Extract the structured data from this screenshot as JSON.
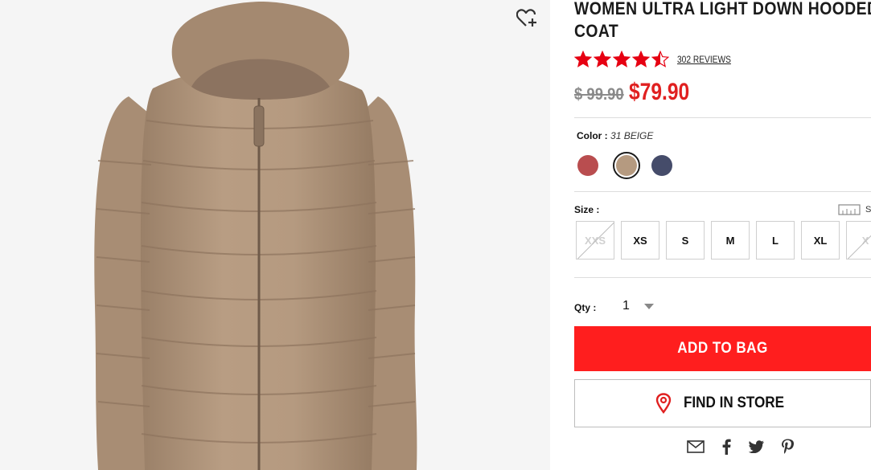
{
  "product": {
    "title_line1": "WOMEN ULTRA LIGHT DOWN HOODED",
    "title_line2": "COAT",
    "rating": 4.5,
    "reviews_label": "302 REVIEWS",
    "price_original": "$ 99.90",
    "price_sale": "$79.90",
    "image_alt": "Beige ultra light down hooded coat"
  },
  "color": {
    "label": "Color :",
    "selected": "31 BEIGE",
    "swatches": [
      {
        "name": "red",
        "hex": "#b94d4f",
        "selected": false
      },
      {
        "name": "beige",
        "hex": "#b59a80",
        "selected": true
      },
      {
        "name": "navy",
        "hex": "#454c6a",
        "selected": false
      }
    ]
  },
  "size": {
    "label": "Size :",
    "guide_label": "S",
    "options": [
      {
        "label": "XXS",
        "available": false
      },
      {
        "label": "XS",
        "available": true
      },
      {
        "label": "S",
        "available": true
      },
      {
        "label": "M",
        "available": true
      },
      {
        "label": "L",
        "available": true
      },
      {
        "label": "XL",
        "available": true
      },
      {
        "label": "X",
        "available": false
      }
    ]
  },
  "quantity": {
    "label": "Qty :",
    "value": "1"
  },
  "actions": {
    "add_to_bag": "ADD TO BAG",
    "find_in_store": "FIND IN STORE"
  },
  "share": {
    "icons": [
      "email-icon",
      "facebook-icon",
      "twitter-icon",
      "pinterest-icon"
    ]
  },
  "colors": {
    "accent_red": "#ff1e1e",
    "sale_red": "#e02020",
    "star_red": "#e60012"
  }
}
